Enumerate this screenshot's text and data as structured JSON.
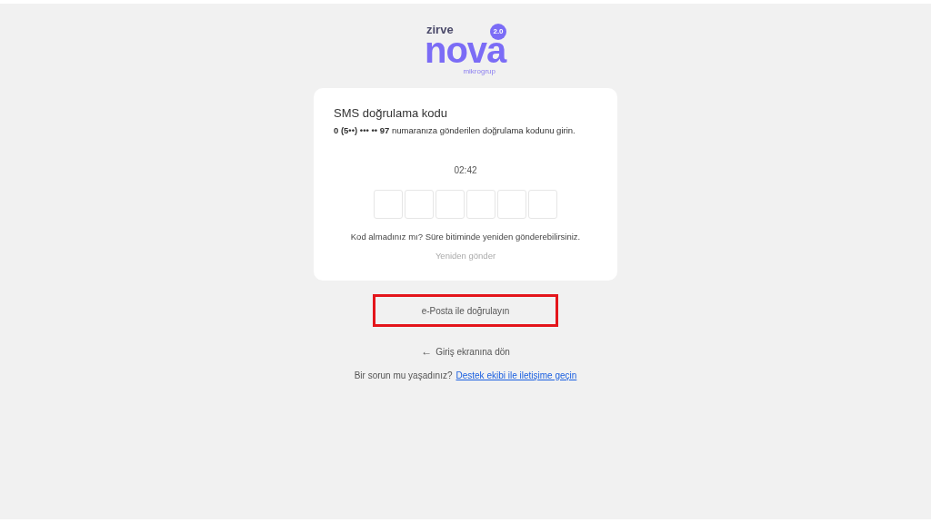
{
  "logo": {
    "top": "zirve",
    "main": "nova",
    "badge": "2.0",
    "sub": "mikrogrup"
  },
  "card": {
    "title": "SMS doğrulama kodu",
    "message": "**0 (5••) ••• •• 97** numaranıza gönderilen doğrulama kodunu girin.",
    "timer": "02:42",
    "hint": "Kod almadınız mı? Süre bitiminde yeniden gönderebilirsiniz.",
    "resend": {
      "label": "Yeniden gönder",
      "disabled": true
    }
  },
  "email_button": {
    "label": "e-Posta ile doğrulayın",
    "highlighted": true
  },
  "back_link": {
    "icon": "←",
    "label": "Giriş ekranına dön"
  },
  "support": {
    "text": "Bir sorun mu yaşadınız?",
    "link": "Destek ekibi ile iletişime geçin"
  }
}
